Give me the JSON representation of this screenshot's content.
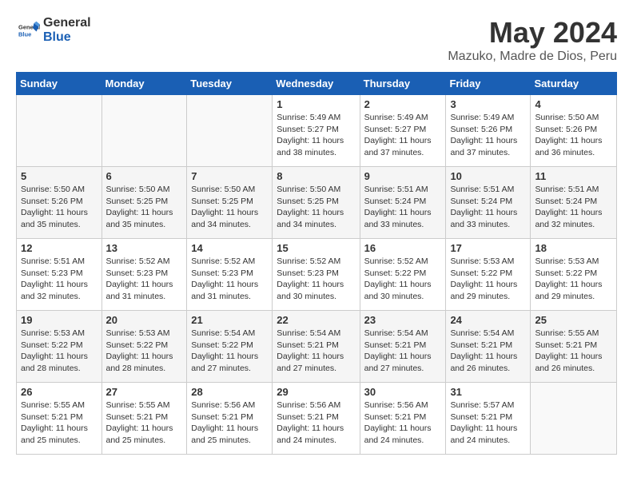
{
  "logo": {
    "general": "General",
    "blue": "Blue"
  },
  "title": "May 2024",
  "location": "Mazuko, Madre de Dios, Peru",
  "days_of_week": [
    "Sunday",
    "Monday",
    "Tuesday",
    "Wednesday",
    "Thursday",
    "Friday",
    "Saturday"
  ],
  "weeks": [
    [
      {
        "day": "",
        "info": ""
      },
      {
        "day": "",
        "info": ""
      },
      {
        "day": "",
        "info": ""
      },
      {
        "day": "1",
        "info": "Sunrise: 5:49 AM\nSunset: 5:27 PM\nDaylight: 11 hours\nand 38 minutes."
      },
      {
        "day": "2",
        "info": "Sunrise: 5:49 AM\nSunset: 5:27 PM\nDaylight: 11 hours\nand 37 minutes."
      },
      {
        "day": "3",
        "info": "Sunrise: 5:49 AM\nSunset: 5:26 PM\nDaylight: 11 hours\nand 37 minutes."
      },
      {
        "day": "4",
        "info": "Sunrise: 5:50 AM\nSunset: 5:26 PM\nDaylight: 11 hours\nand 36 minutes."
      }
    ],
    [
      {
        "day": "5",
        "info": "Sunrise: 5:50 AM\nSunset: 5:26 PM\nDaylight: 11 hours\nand 35 minutes."
      },
      {
        "day": "6",
        "info": "Sunrise: 5:50 AM\nSunset: 5:25 PM\nDaylight: 11 hours\nand 35 minutes."
      },
      {
        "day": "7",
        "info": "Sunrise: 5:50 AM\nSunset: 5:25 PM\nDaylight: 11 hours\nand 34 minutes."
      },
      {
        "day": "8",
        "info": "Sunrise: 5:50 AM\nSunset: 5:25 PM\nDaylight: 11 hours\nand 34 minutes."
      },
      {
        "day": "9",
        "info": "Sunrise: 5:51 AM\nSunset: 5:24 PM\nDaylight: 11 hours\nand 33 minutes."
      },
      {
        "day": "10",
        "info": "Sunrise: 5:51 AM\nSunset: 5:24 PM\nDaylight: 11 hours\nand 33 minutes."
      },
      {
        "day": "11",
        "info": "Sunrise: 5:51 AM\nSunset: 5:24 PM\nDaylight: 11 hours\nand 32 minutes."
      }
    ],
    [
      {
        "day": "12",
        "info": "Sunrise: 5:51 AM\nSunset: 5:23 PM\nDaylight: 11 hours\nand 32 minutes."
      },
      {
        "day": "13",
        "info": "Sunrise: 5:52 AM\nSunset: 5:23 PM\nDaylight: 11 hours\nand 31 minutes."
      },
      {
        "day": "14",
        "info": "Sunrise: 5:52 AM\nSunset: 5:23 PM\nDaylight: 11 hours\nand 31 minutes."
      },
      {
        "day": "15",
        "info": "Sunrise: 5:52 AM\nSunset: 5:23 PM\nDaylight: 11 hours\nand 30 minutes."
      },
      {
        "day": "16",
        "info": "Sunrise: 5:52 AM\nSunset: 5:22 PM\nDaylight: 11 hours\nand 30 minutes."
      },
      {
        "day": "17",
        "info": "Sunrise: 5:53 AM\nSunset: 5:22 PM\nDaylight: 11 hours\nand 29 minutes."
      },
      {
        "day": "18",
        "info": "Sunrise: 5:53 AM\nSunset: 5:22 PM\nDaylight: 11 hours\nand 29 minutes."
      }
    ],
    [
      {
        "day": "19",
        "info": "Sunrise: 5:53 AM\nSunset: 5:22 PM\nDaylight: 11 hours\nand 28 minutes."
      },
      {
        "day": "20",
        "info": "Sunrise: 5:53 AM\nSunset: 5:22 PM\nDaylight: 11 hours\nand 28 minutes."
      },
      {
        "day": "21",
        "info": "Sunrise: 5:54 AM\nSunset: 5:22 PM\nDaylight: 11 hours\nand 27 minutes."
      },
      {
        "day": "22",
        "info": "Sunrise: 5:54 AM\nSunset: 5:21 PM\nDaylight: 11 hours\nand 27 minutes."
      },
      {
        "day": "23",
        "info": "Sunrise: 5:54 AM\nSunset: 5:21 PM\nDaylight: 11 hours\nand 27 minutes."
      },
      {
        "day": "24",
        "info": "Sunrise: 5:54 AM\nSunset: 5:21 PM\nDaylight: 11 hours\nand 26 minutes."
      },
      {
        "day": "25",
        "info": "Sunrise: 5:55 AM\nSunset: 5:21 PM\nDaylight: 11 hours\nand 26 minutes."
      }
    ],
    [
      {
        "day": "26",
        "info": "Sunrise: 5:55 AM\nSunset: 5:21 PM\nDaylight: 11 hours\nand 25 minutes."
      },
      {
        "day": "27",
        "info": "Sunrise: 5:55 AM\nSunset: 5:21 PM\nDaylight: 11 hours\nand 25 minutes."
      },
      {
        "day": "28",
        "info": "Sunrise: 5:56 AM\nSunset: 5:21 PM\nDaylight: 11 hours\nand 25 minutes."
      },
      {
        "day": "29",
        "info": "Sunrise: 5:56 AM\nSunset: 5:21 PM\nDaylight: 11 hours\nand 24 minutes."
      },
      {
        "day": "30",
        "info": "Sunrise: 5:56 AM\nSunset: 5:21 PM\nDaylight: 11 hours\nand 24 minutes."
      },
      {
        "day": "31",
        "info": "Sunrise: 5:57 AM\nSunset: 5:21 PM\nDaylight: 11 hours\nand 24 minutes."
      },
      {
        "day": "",
        "info": ""
      }
    ]
  ]
}
